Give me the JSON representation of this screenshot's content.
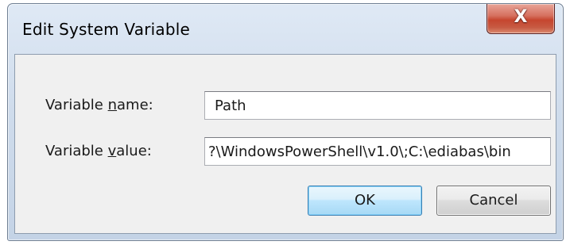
{
  "dialog": {
    "title": "Edit System Variable",
    "close_glyph": "X"
  },
  "fields": {
    "name": {
      "label_prefix": "Variable ",
      "label_accel": "n",
      "label_suffix": "ame:",
      "value": "Path"
    },
    "value": {
      "label_prefix": "Variable ",
      "label_accel": "v",
      "label_suffix": "alue:",
      "value": "?\\WindowsPowerShell\\v1.0\\;C:\\ediabas\\bin"
    }
  },
  "buttons": {
    "ok_label": "OK",
    "cancel_label": "Cancel"
  },
  "icons": {
    "close": "close-icon"
  },
  "colors": {
    "close_button": "#c6462f",
    "ok_border": "#3c7fb1"
  }
}
